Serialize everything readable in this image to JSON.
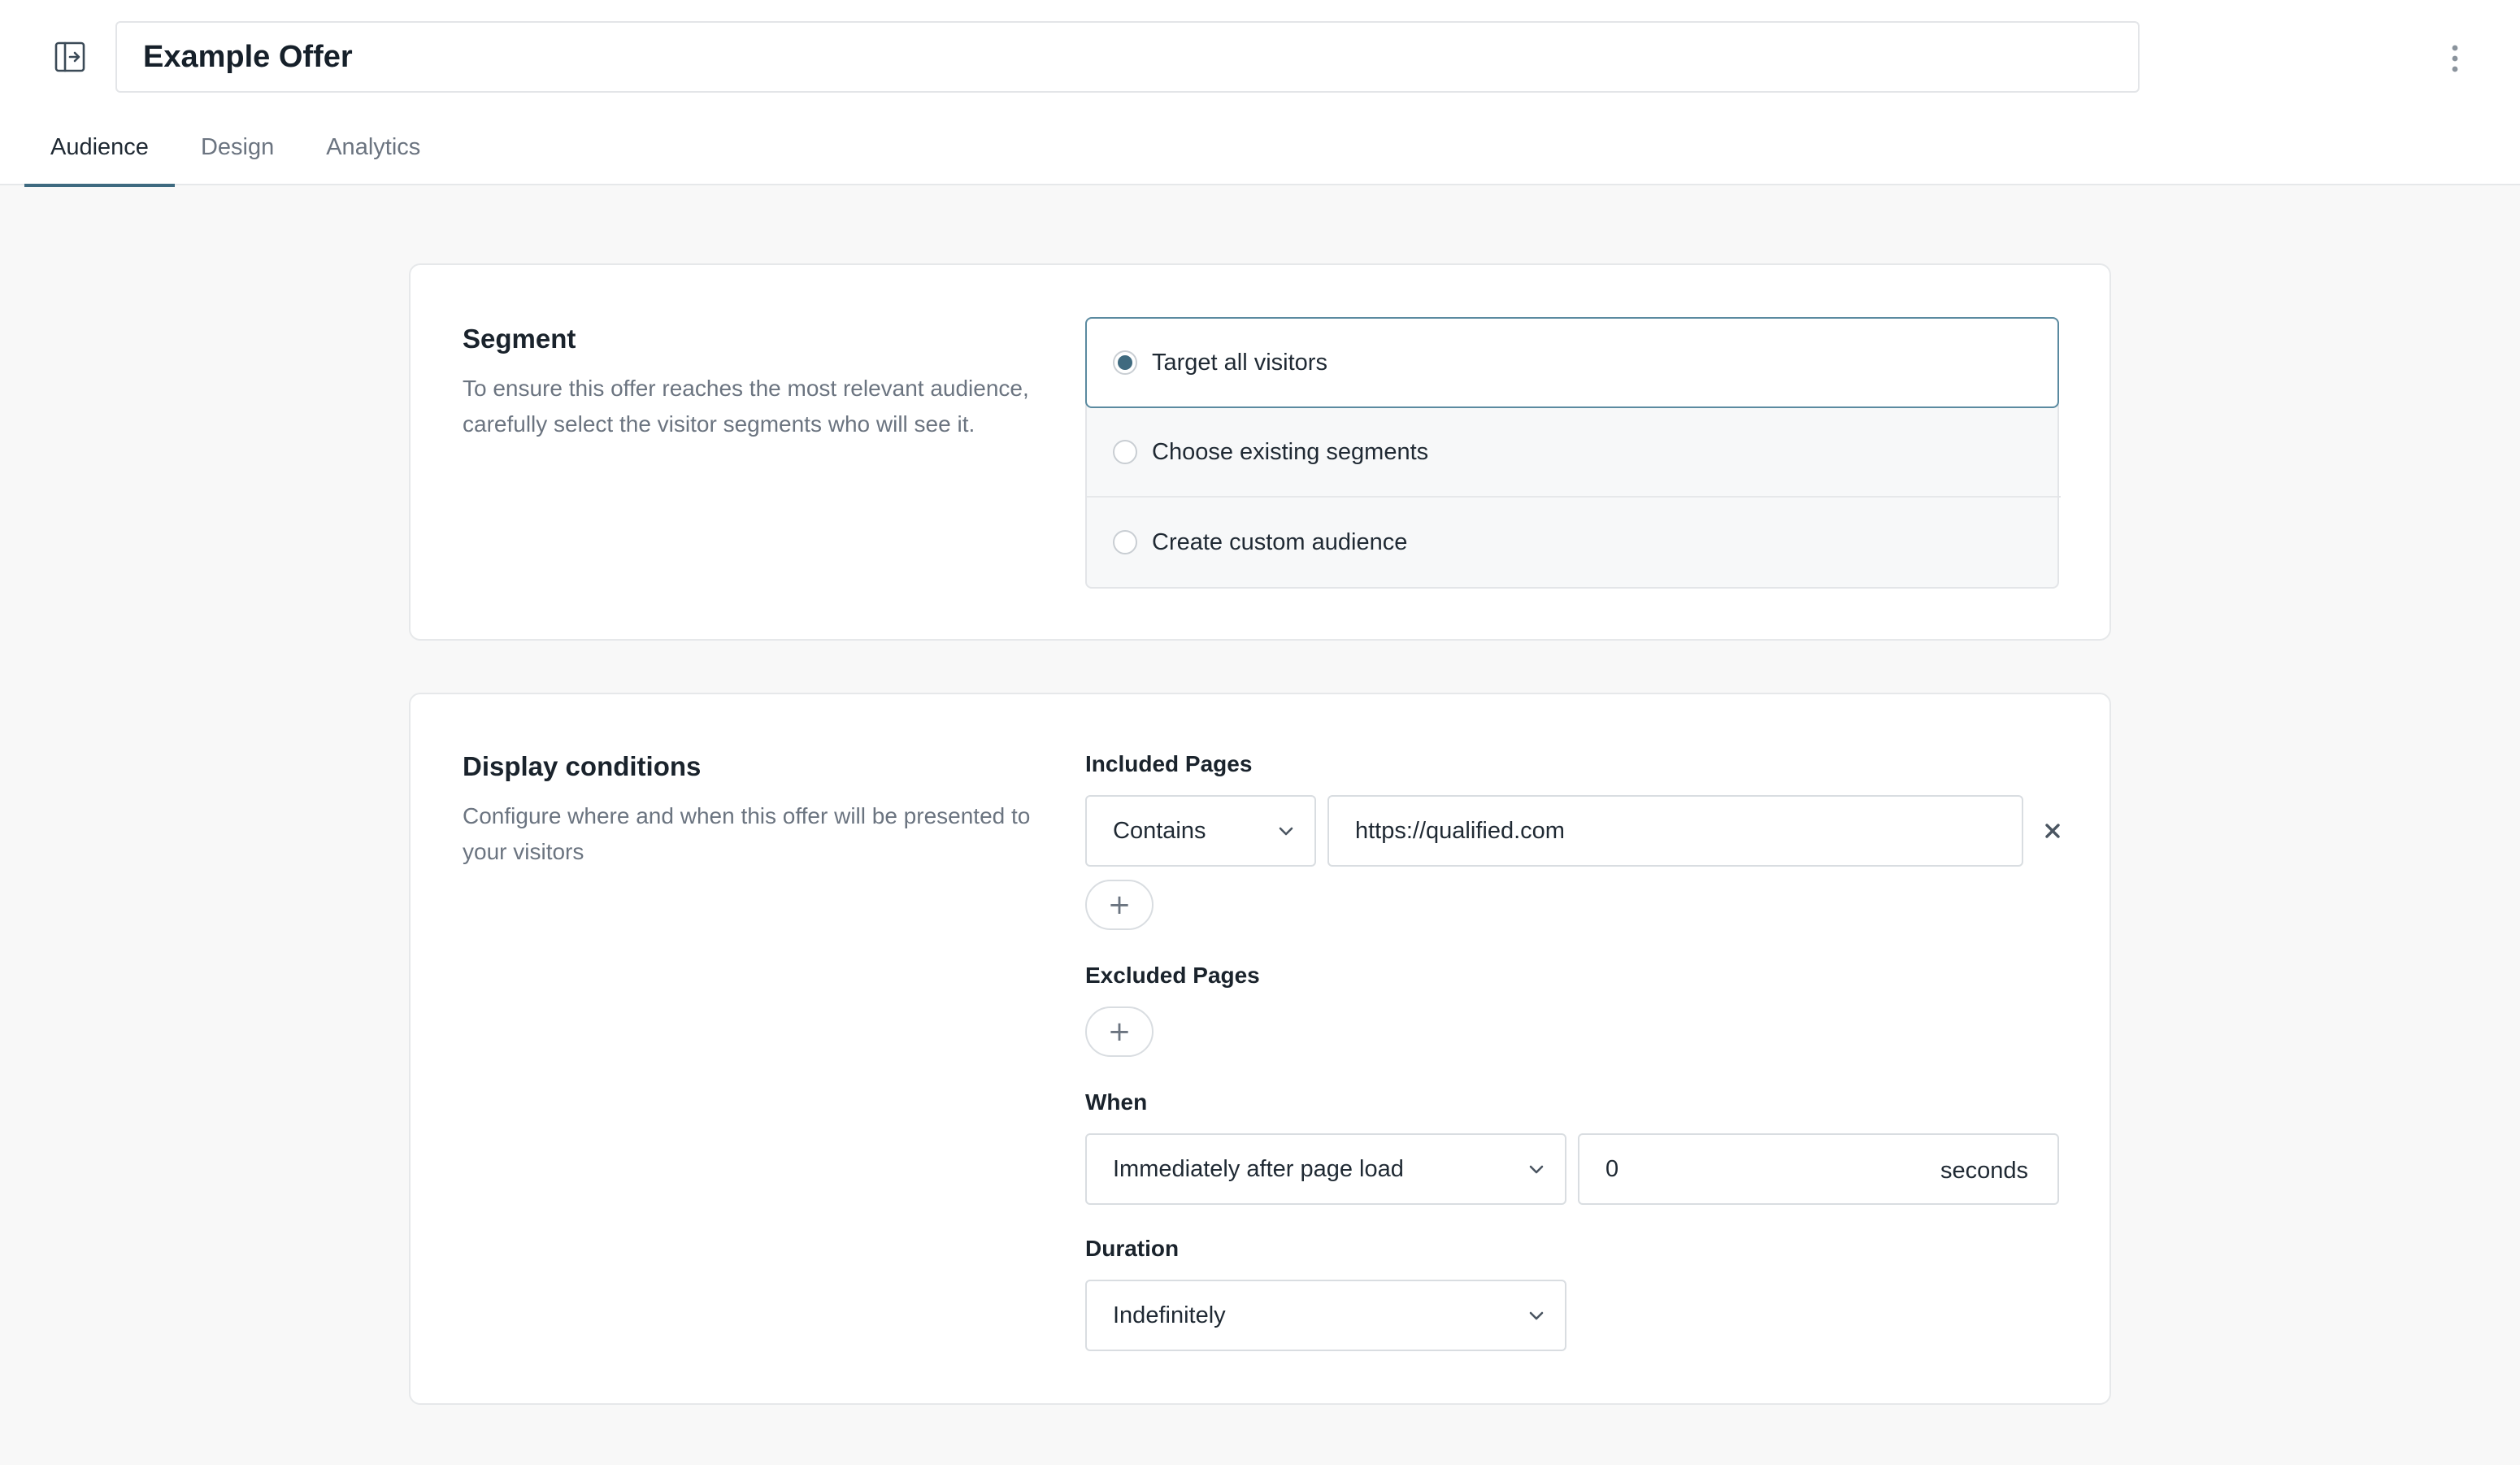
{
  "header": {
    "title_value": "Example Offer",
    "sidebar_toggle_icon": "panel-expand-icon",
    "menu_icon": "more-vertical-icon"
  },
  "tabs": [
    {
      "label": "Audience",
      "active": true
    },
    {
      "label": "Design",
      "active": false
    },
    {
      "label": "Analytics",
      "active": false
    }
  ],
  "segment": {
    "title": "Segment",
    "description": "To ensure this offer reaches the most relevant audience, carefully select the visitor segments who will see it.",
    "options": [
      {
        "label": "Target all visitors",
        "selected": true
      },
      {
        "label": "Choose existing segments",
        "selected": false
      },
      {
        "label": "Create custom audience",
        "selected": false
      }
    ]
  },
  "display_conditions": {
    "title": "Display conditions",
    "description": "Configure where and when this offer will be presented to your visitors",
    "included_pages": {
      "label": "Included Pages",
      "rules": [
        {
          "operator": "Contains",
          "value": "https://qualified.com"
        }
      ],
      "add_label": "+"
    },
    "excluded_pages": {
      "label": "Excluded Pages",
      "add_label": "+"
    },
    "when": {
      "label": "When",
      "selected": "Immediately after page load",
      "delay_value": "0",
      "delay_unit": "seconds"
    },
    "duration": {
      "label": "Duration",
      "selected": "Indefinitely"
    }
  },
  "colors": {
    "accent": "#3e6a80",
    "border": "#e3e5e8",
    "muted_text": "#6b7480",
    "background": "#f8f8f8"
  }
}
